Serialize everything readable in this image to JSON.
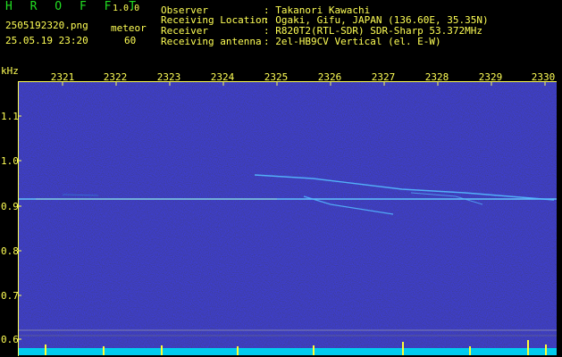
{
  "app": {
    "name": "H R O F F T",
    "version": "1.0.0"
  },
  "file": {
    "name": "2505192320.png",
    "datetime": "25.05.19 23:20"
  },
  "meteor": {
    "label": "meteor",
    "count": "60"
  },
  "info": {
    "observer_label": "Observer",
    "observer_value": ": Takanori Kawachi",
    "location_label": "Receiving Location",
    "location_value": ": Ogaki, Gifu, JAPAN (136.60E, 35.35N)",
    "receiver_label": "Receiver",
    "receiver_value": ": R820T2(RTL-SDR) SDR-Sharp 53.372MHz",
    "antenna_label": "Receiving antenna",
    "antenna_value": ": 2el-HB9CV Vertical (el. E-W)"
  },
  "axes": {
    "y_unit": "kHz",
    "x_ticks": [
      "2321",
      "2322",
      "2323",
      "2324",
      "2325",
      "2326",
      "2327",
      "2328",
      "2329",
      "2330"
    ],
    "y_ticks": [
      "1.1",
      "1.0",
      "0.9",
      "0.8",
      "0.7",
      "0.6"
    ]
  },
  "colors": {
    "label": "#ffff55",
    "brand": "#22dd22",
    "trace": "#66ccff",
    "background": "#06062a"
  }
}
